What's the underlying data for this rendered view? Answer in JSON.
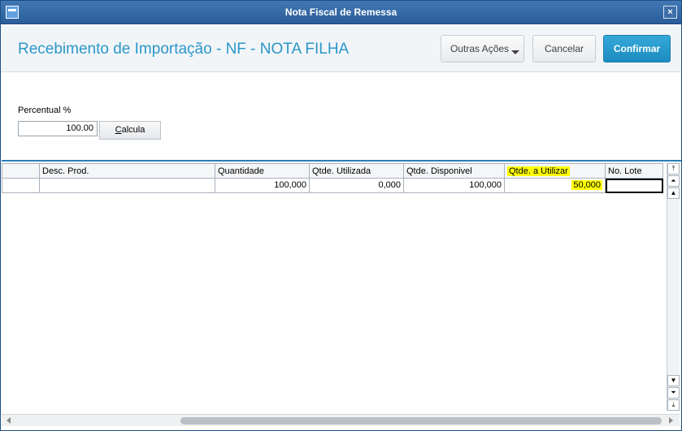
{
  "window": {
    "title": "Nota Fiscal de Remessa",
    "close_label": "×"
  },
  "header": {
    "page_title": "Recebimento de Importação - NF - NOTA FILHA",
    "buttons": {
      "outras_acoes": "Outras Ações",
      "cancelar": "Cancelar",
      "confirmar": "Confirmar"
    }
  },
  "form": {
    "percentual_label": "Percentual %",
    "percentual_value": "100.00",
    "calcula_first": "C",
    "calcula_rest": "alcula"
  },
  "grid": {
    "columns": [
      "",
      "Desc. Prod.",
      "Quantidade",
      "Qtde. Utilizada",
      "Qtde. Disponivel",
      "Qtde. a Utilizar",
      "No. Lote"
    ],
    "highlighted_column": "Qtde. a Utilizar",
    "rows": [
      {
        "c0": "",
        "desc": "",
        "quantidade": "100,000",
        "utilizada": "0,000",
        "disponivel": "100,000",
        "a_utilizar": "50,000",
        "lote": ""
      }
    ]
  },
  "colors": {
    "accent": "#2b97c9",
    "confirm_button": "#1d8cc0",
    "titlebar": "#2a5d99",
    "highlight": "#ffff00"
  },
  "icons": {
    "app": "window-app-icon",
    "close": "close-icon",
    "dropdown": "caret-down-icon",
    "scroll_top": "scroll-top-icon",
    "scroll_page_up": "scroll-page-up-icon",
    "scroll_up": "scroll-up-icon",
    "scroll_down": "scroll-down-icon",
    "scroll_page_down": "scroll-page-down-icon",
    "scroll_bottom": "scroll-bottom-icon"
  }
}
